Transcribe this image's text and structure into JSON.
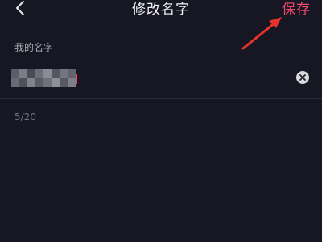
{
  "header": {
    "back_icon": "chevron-left-icon",
    "title": "修改名字",
    "save_label": "保存"
  },
  "name_field": {
    "label": "我的名字",
    "value": "",
    "clear_icon": "clear-circle-icon",
    "counter": "5/20"
  },
  "colors": {
    "background": "#161722",
    "accent": "#f0486a",
    "title_text": "#f2f2f6",
    "muted_text": "#a9aab2",
    "divider": "#2a2b37",
    "annotation_arrow": "#e8322e"
  }
}
